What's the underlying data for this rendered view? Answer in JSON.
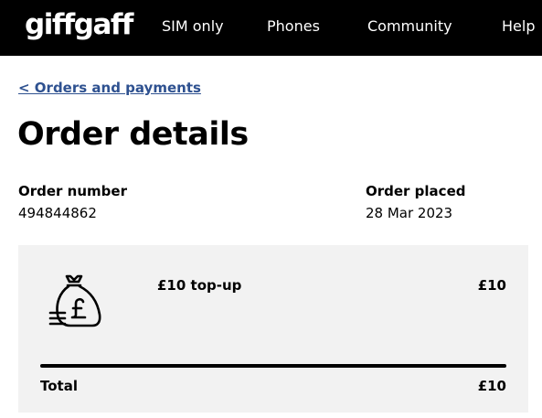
{
  "header": {
    "logo_text": "giffgaff",
    "nav": {
      "sim_only": "SIM only",
      "phones": "Phones",
      "community": "Community",
      "help": "Help"
    }
  },
  "breadcrumb": {
    "back_label": "< Orders and payments"
  },
  "page": {
    "title": "Order details"
  },
  "order_meta": {
    "number_label": "Order number",
    "number_value": "494844862",
    "placed_label": "Order placed",
    "placed_value": "28 Mar 2023"
  },
  "order_card": {
    "icon": "money-bag-icon",
    "item_name": "£10 top-up",
    "item_price": "£10",
    "total_label": "Total",
    "total_value": "£10"
  },
  "colors": {
    "header_bg": "#000000",
    "link": "#2e5190",
    "card_bg": "#f2f2f2"
  }
}
